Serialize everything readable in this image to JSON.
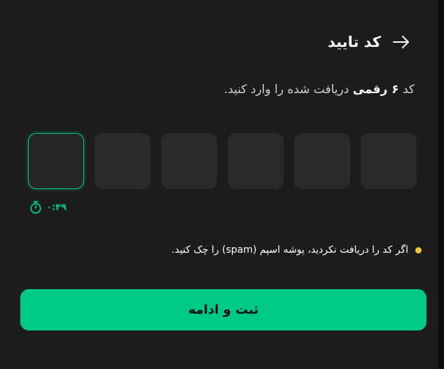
{
  "header": {
    "title": "کد تایید",
    "back_icon": "arrow-right-icon"
  },
  "instruction": {
    "prefix": "کد",
    "digits": "۶ رقمی",
    "suffix": "دریافت شده را وارد کنید."
  },
  "otp": {
    "length": 6,
    "values": [
      "",
      "",
      "",
      "",
      "",
      ""
    ]
  },
  "timer": {
    "text": "۰:۴۹",
    "icon": "stopwatch-icon"
  },
  "note": {
    "text": "اگر کد را دریافت نکردید، پوشه اسپم (spam) را چک کنید."
  },
  "submit": {
    "label": "ثبت و ادامه"
  },
  "colors": {
    "accent": "#00c985",
    "background": "#1c1c1c",
    "input": "#2a2a2a",
    "warning_dot": "#f5c440"
  }
}
